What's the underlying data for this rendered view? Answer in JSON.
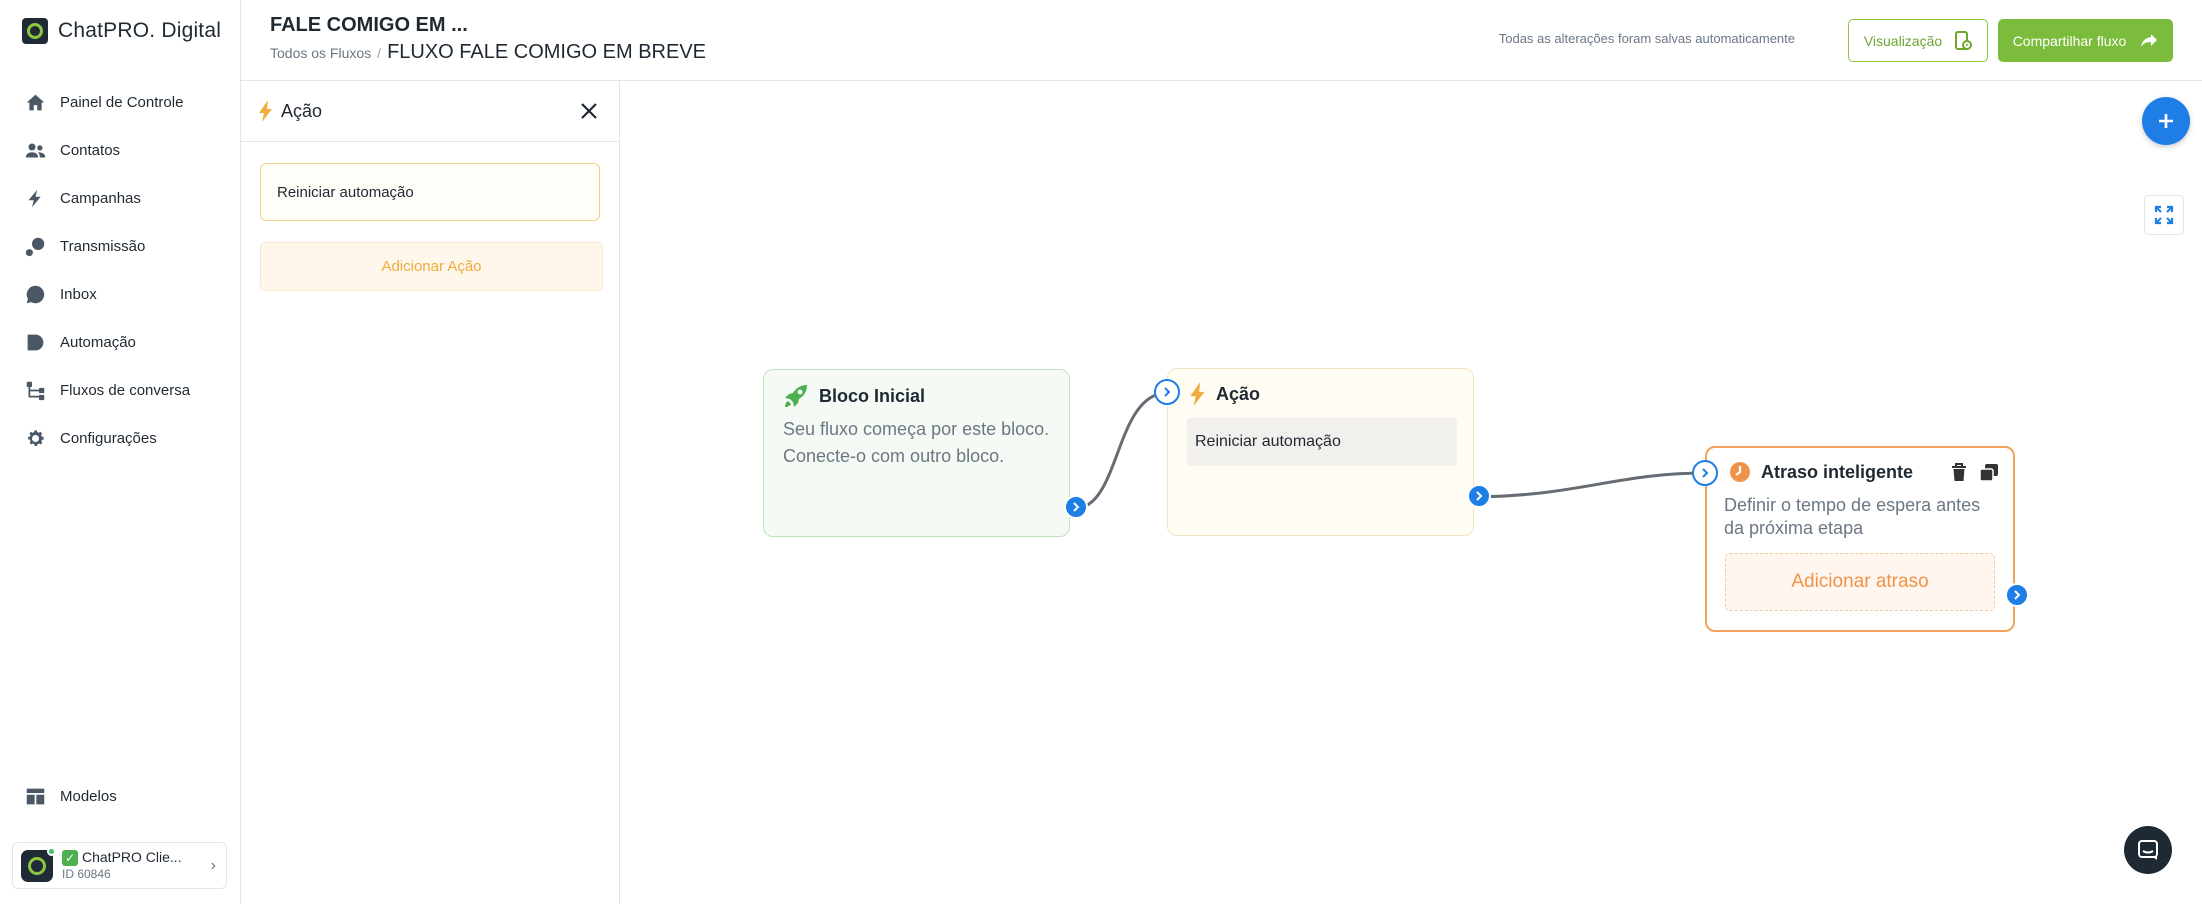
{
  "brand": {
    "name": "ChatPRO. Digital"
  },
  "sidebar": {
    "items": [
      {
        "label": "Painel de Controle",
        "icon": "home-icon"
      },
      {
        "label": "Contatos",
        "icon": "users-icon"
      },
      {
        "label": "Campanhas",
        "icon": "bolt-icon"
      },
      {
        "label": "Transmissão",
        "icon": "broadcast-icon"
      },
      {
        "label": "Inbox",
        "icon": "chat-icon"
      },
      {
        "label": "Automação",
        "icon": "automation-icon"
      },
      {
        "label": "Fluxos de conversa",
        "icon": "flow-icon"
      },
      {
        "label": "Configurações",
        "icon": "gear-icon"
      }
    ],
    "bottom": {
      "label": "Modelos",
      "icon": "templates-icon"
    },
    "account": {
      "name": "ChatPRO Clie...",
      "id": "ID 60846"
    }
  },
  "header": {
    "title": "FALE COMIGO EM ...",
    "breadcrumb_root": "Todos os Fluxos",
    "breadcrumb_sep": "/",
    "breadcrumb_current": "FLUXO FALE COMIGO EM BREVE",
    "autosave": "Todas as alterações foram salvas automaticamente",
    "preview_label": "Visualização",
    "share_label": "Compartilhar fluxo"
  },
  "panel": {
    "title": "Ação",
    "action_item": "Reiniciar automação",
    "add_action": "Adicionar Ação"
  },
  "canvas": {
    "start_node": {
      "title": "Bloco Inicial",
      "description": "Seu fluxo começa por este bloco. Conecte-o com outro bloco."
    },
    "action_node": {
      "title": "Ação",
      "action": "Reiniciar automação"
    },
    "delay_node": {
      "title": "Atraso inteligente",
      "description": "Definir o tempo de espera antes da próxima etapa",
      "add_delay": "Adicionar atraso"
    }
  },
  "colors": {
    "primary_blue": "#1e7ee6",
    "brand_green": "#7cbc3c",
    "action_amber": "#f0ac3c",
    "delay_orange": "#f0a35a"
  }
}
